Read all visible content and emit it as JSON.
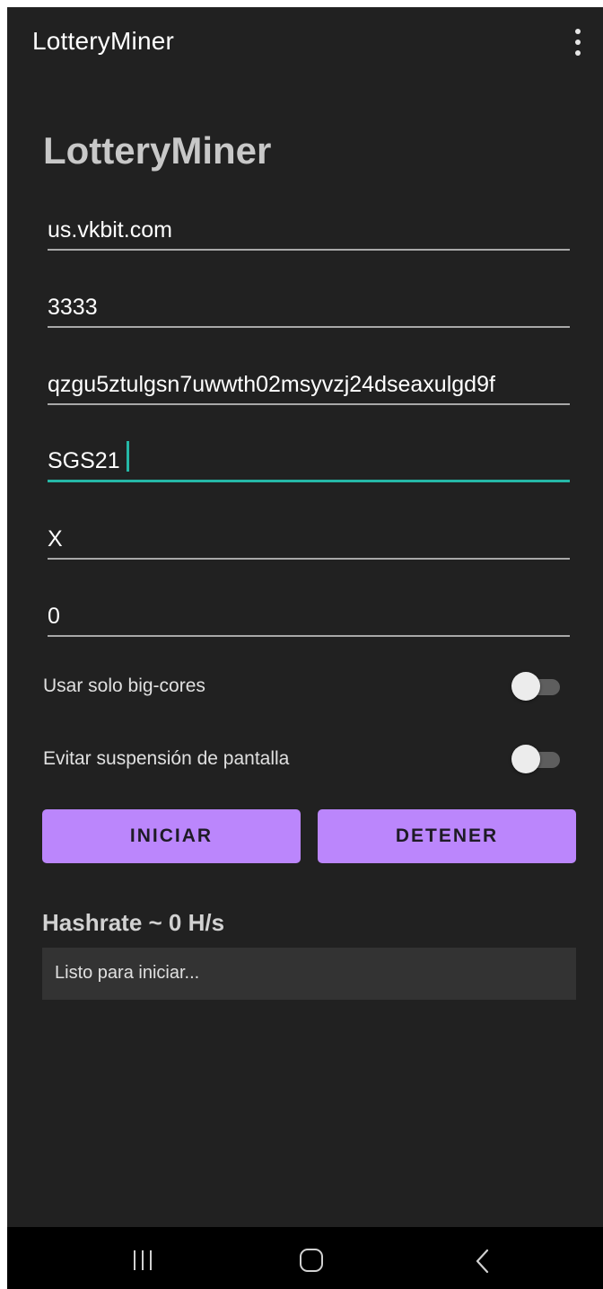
{
  "app": {
    "title": "LotteryMiner",
    "menu_icon": "more-vert-icon"
  },
  "page": {
    "heading": "LotteryMiner"
  },
  "form": {
    "pool_host": "us.vkbit.com",
    "pool_port": "3333",
    "wallet_address": "qzgu5ztulgsn7uwwth02msyvzj24dseaxulgd9f",
    "worker_name": "SGS21",
    "password": "X",
    "threads": "0"
  },
  "switches": {
    "big_cores": {
      "label": "Usar solo big-cores",
      "checked": false
    },
    "keep_screen_on": {
      "label": "Evitar suspensión de pantalla",
      "checked": false
    }
  },
  "buttons": {
    "start_label": "INICIAR",
    "stop_label": "DETENER"
  },
  "status": {
    "hashrate": "Hashrate ~ 0 H/s",
    "log": "Listo para iniciar..."
  },
  "nav": {
    "recents_icon": "recents-icon",
    "home_icon": "home-icon",
    "back_icon": "back-icon"
  },
  "colors": {
    "background": "#212121",
    "accent_button": "#bb86fc",
    "focus_underline": "#26b8a7",
    "log_background": "#333333"
  }
}
